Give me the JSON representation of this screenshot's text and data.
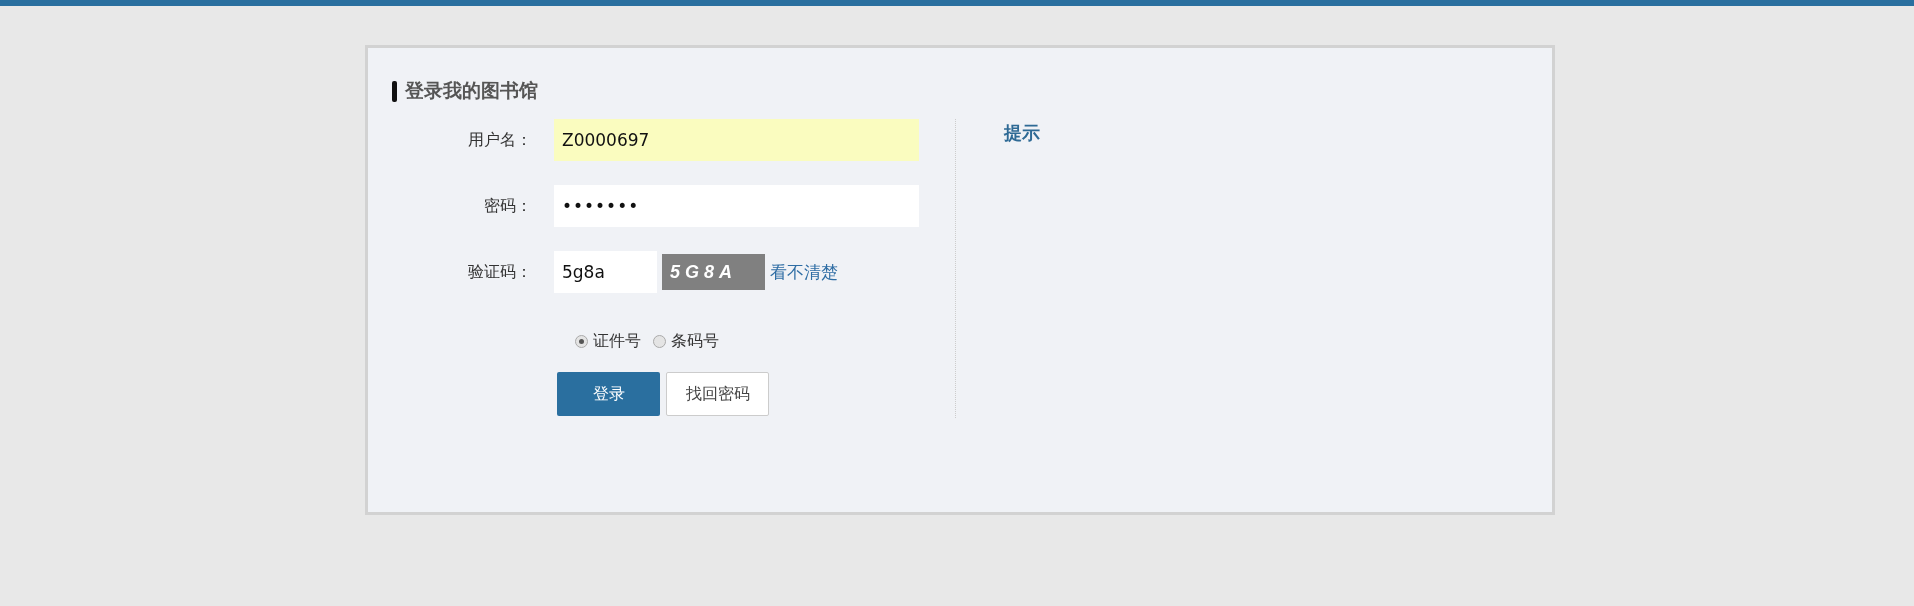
{
  "panel": {
    "title": "登录我的图书馆"
  },
  "fields": [
    {
      "kind": "text",
      "label": "用户名：",
      "value": "Z0000697",
      "highlighted": true
    },
    {
      "kind": "password",
      "label": "密码：",
      "value": "•••••••",
      "highlighted": false
    },
    {
      "kind": "captcha",
      "label": "验证码：",
      "value": "5g8a",
      "highlighted": false,
      "captcha_text": "5G8A",
      "refresh_link": "看不清楚"
    }
  ],
  "id_types": [
    {
      "label": "证件号",
      "selected": true
    },
    {
      "label": "条码号",
      "selected": false
    }
  ],
  "buttons": [
    {
      "kind": "primary",
      "label": "登录"
    },
    {
      "kind": "secondary",
      "label": "找回密码"
    }
  ],
  "hint": {
    "title": "提示"
  }
}
